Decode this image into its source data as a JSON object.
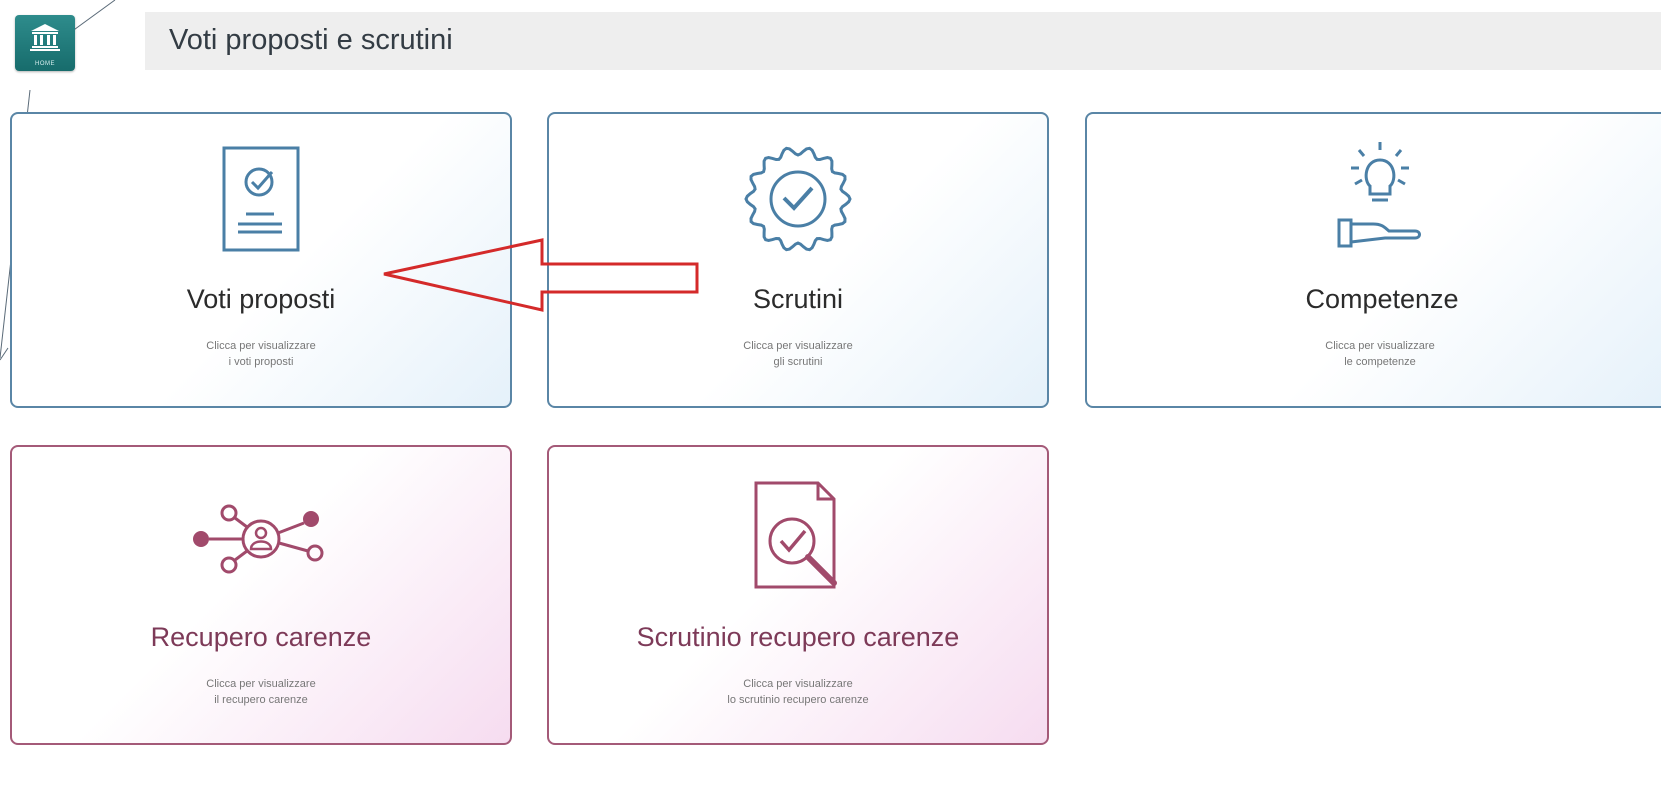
{
  "header": {
    "home_label": "HOME",
    "title": "Voti proposti e scrutini"
  },
  "colors": {
    "accent_teal": "#1f7a7a",
    "tile_blue_border": "#5a86a6",
    "tile_pink_border": "#a45a78",
    "arrow_red": "#d42a2a"
  },
  "tiles": [
    {
      "title": "Voti proposti",
      "desc_line1": "Clicca per visualizzare",
      "desc_line2": "i voti proposti",
      "icon": "document-check-icon"
    },
    {
      "title": "Scrutini",
      "desc_line1": "Clicca per visualizzare",
      "desc_line2": "gli scrutini",
      "icon": "badge-check-icon"
    },
    {
      "title": "Competenze",
      "desc_line1": "Clicca per visualizzare",
      "desc_line2": "le competenze",
      "icon": "lightbulb-hand-icon"
    },
    {
      "title": "Recupero carenze",
      "desc_line1": "Clicca per visualizzare",
      "desc_line2": "il recupero carenze",
      "icon": "network-user-icon"
    },
    {
      "title": "Scrutinio recupero carenze",
      "desc_line1": "Clicca per visualizzare",
      "desc_line2": "lo scrutinio recupero carenze",
      "icon": "document-search-icon"
    }
  ],
  "annotation": {
    "icon": "red-arrow-icon"
  }
}
